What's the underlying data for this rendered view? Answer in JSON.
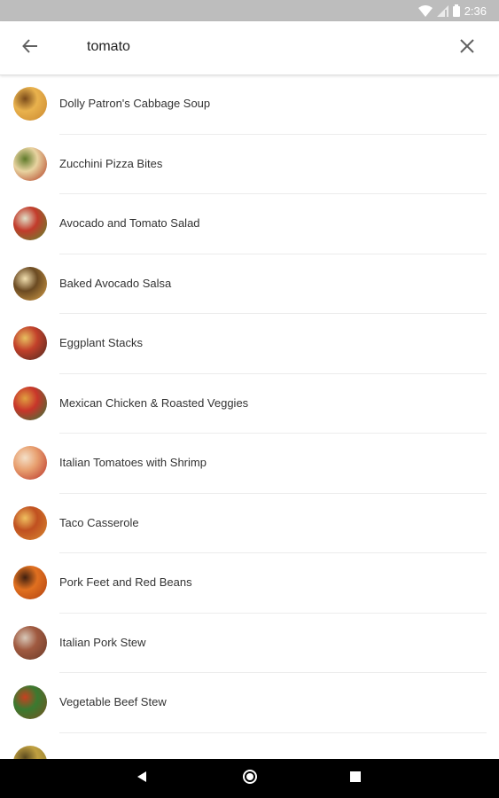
{
  "status_bar": {
    "time": "2:36",
    "icons": [
      "wifi-icon",
      "signal-icon",
      "battery-icon"
    ]
  },
  "search": {
    "query": "tomato",
    "back_icon": "arrow-left-icon",
    "clear_icon": "close-icon"
  },
  "results": [
    {
      "label": "Dolly Patron's Cabbage Soup",
      "colors": [
        "#c9862e",
        "#e9b24d",
        "#7a4a1a"
      ]
    },
    {
      "label": "Zucchini Pizza Bites",
      "colors": [
        "#b0381f",
        "#e8d3a0",
        "#5f7a2a"
      ]
    },
    {
      "label": "Avocado and Tomato Salad",
      "colors": [
        "#5c8c2e",
        "#c23b2b",
        "#e0e0c8"
      ]
    },
    {
      "label": "Baked Avocado Salsa",
      "colors": [
        "#d8a24a",
        "#6b4a22",
        "#f2e0b0"
      ]
    },
    {
      "label": "Eggplant Stacks",
      "colors": [
        "#4a2a20",
        "#c2402a",
        "#e8c060"
      ]
    },
    {
      "label": "Mexican Chicken & Roasted Veggies",
      "colors": [
        "#2e7a3a",
        "#c8352a",
        "#e0a040"
      ]
    },
    {
      "label": "Italian Tomatoes with Shrimp",
      "colors": [
        "#b83028",
        "#e8a070",
        "#f4e0c8"
      ]
    },
    {
      "label": "Taco Casserole",
      "colors": [
        "#d88a30",
        "#c05020",
        "#f0c060"
      ]
    },
    {
      "label": "Pork Feet and Red Beans",
      "colors": [
        "#b04010",
        "#e07020",
        "#402010"
      ]
    },
    {
      "label": "Italian Pork Stew",
      "colors": [
        "#6a3a28",
        "#a05a40",
        "#d8c8b8"
      ]
    },
    {
      "label": "Vegetable Beef Stew",
      "colors": [
        "#7a5020",
        "#3a7a30",
        "#c84020"
      ]
    },
    {
      "label": "",
      "colors": [
        "#8a7a30",
        "#c0a040",
        "#5a4a20"
      ]
    }
  ],
  "nav_bar": {
    "back_icon": "nav-back-icon",
    "home_icon": "nav-home-icon",
    "recents_icon": "nav-recents-icon"
  }
}
